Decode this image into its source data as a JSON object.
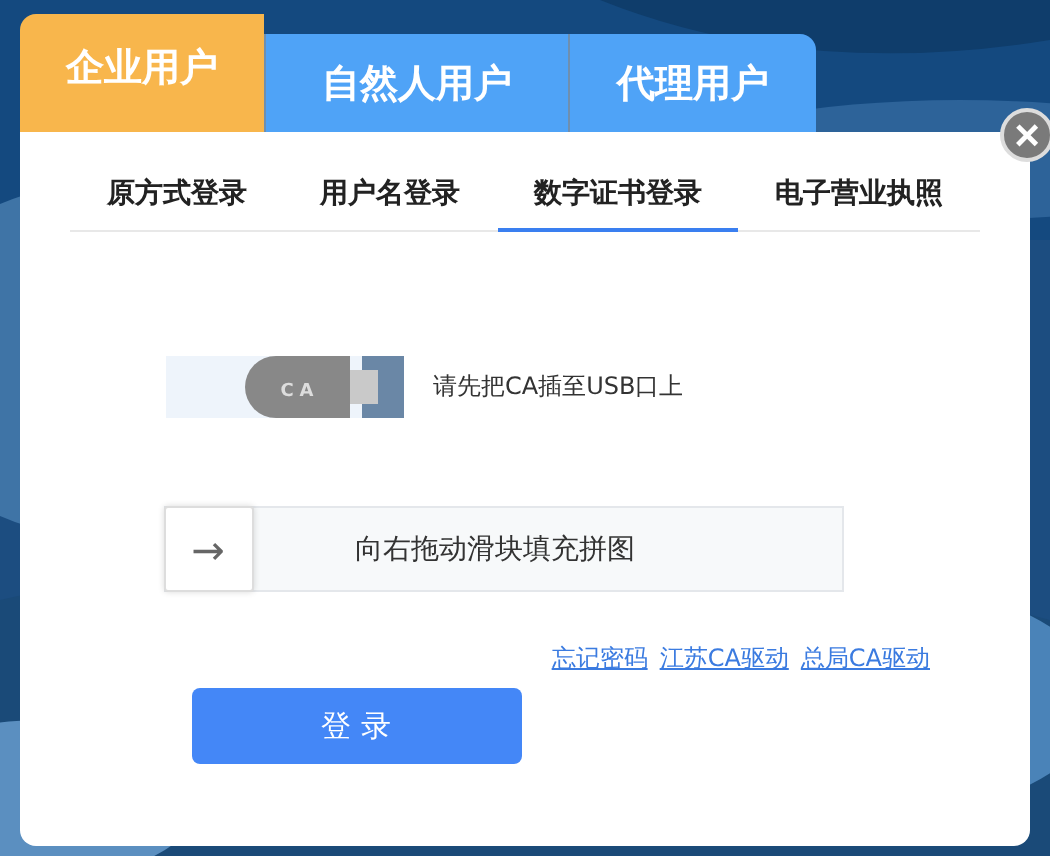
{
  "user_tabs": [
    {
      "label": "企业用户",
      "selected": true
    },
    {
      "label": "自然人用户",
      "selected": false
    },
    {
      "label": "代理用户",
      "selected": false
    }
  ],
  "close": {
    "label": "×"
  },
  "login_tabs": [
    {
      "label": "原方式登录",
      "selected": false
    },
    {
      "label": "用户名登录",
      "selected": false
    },
    {
      "label": "数字证书登录",
      "selected": true
    },
    {
      "label": "电子营业执照",
      "selected": false
    }
  ],
  "ca": {
    "badge": "CA",
    "hint": "请先把CA插至USB口上"
  },
  "slider": {
    "arrow": "→",
    "text": "向右拖动滑块填充拼图",
    "level": 0
  },
  "links": [
    "忘记密码",
    "江苏CA驱动",
    "总局CA驱动"
  ],
  "login_button": "登 录"
}
